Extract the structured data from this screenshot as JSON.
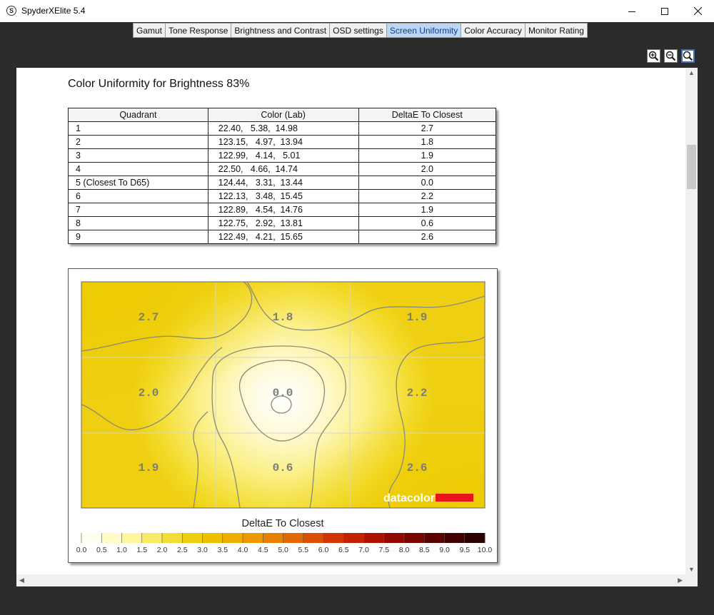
{
  "window": {
    "title": "SpyderXElite 5.4",
    "icon_letter": "S"
  },
  "tabs": [
    {
      "label": "Gamut",
      "active": false
    },
    {
      "label": "Tone Response",
      "active": false
    },
    {
      "label": "Brightness and Contrast",
      "active": false
    },
    {
      "label": "OSD settings",
      "active": false
    },
    {
      "label": "Screen Uniformity",
      "active": true
    },
    {
      "label": "Color Accuracy",
      "active": false
    },
    {
      "label": "Monitor Rating",
      "active": false
    }
  ],
  "report": {
    "heading": "Color Uniformity for Brightness 83%",
    "table": {
      "headers": [
        "Quadrant",
        "Color (Lab)",
        "DeltaE To Closest"
      ],
      "rows": [
        [
          "1",
          "22.40,   5.38,  14.98",
          "2.7"
        ],
        [
          "2",
          "123.15,   4.97,  13.94",
          "1.8"
        ],
        [
          "3",
          "122.99,   4.14,   5.01",
          "1.9"
        ],
        [
          "4",
          "22.50,   4.66,  14.74",
          "2.0"
        ],
        [
          "5 (Closest To D65)",
          "124.44,   3.31,  13.44",
          "0.0"
        ],
        [
          "6",
          "122.13,   3.48,  15.45",
          "2.2"
        ],
        [
          "7",
          "122.89,   4.54,  14.76",
          "1.9"
        ],
        [
          "8",
          "122.75,   2.92,  13.81",
          "0.6"
        ],
        [
          "9",
          "122.49,   4.21,  15.65",
          "2.6"
        ]
      ]
    },
    "uniformity_map": {
      "cells": [
        "2.7",
        "1.8",
        "1.9",
        "2.0",
        "0.0",
        "2.2",
        "1.9",
        "0.6",
        "2.6"
      ],
      "brand": "datacolor",
      "brand_color": "#e8141c"
    },
    "legend": {
      "title": "DeltaE To Closest",
      "labels": [
        "0.0",
        "0.5",
        "1.0",
        "1.5",
        "2.0",
        "2.5",
        "3.0",
        "3.5",
        "4.0",
        "4.5",
        "5.0",
        "5.5",
        "6.0",
        "6.5",
        "7.0",
        "7.5",
        "8.0",
        "8.5",
        "9.0",
        "9.5",
        "10.0"
      ],
      "colors": [
        "#fffff0",
        "#fffcc8",
        "#fff59a",
        "#f8ea66",
        "#f1dd33",
        "#eecf10",
        "#edc000",
        "#eeae00",
        "#ec9800",
        "#e88100",
        "#e36800",
        "#dc4f00",
        "#d23600",
        "#c32200",
        "#ae1300",
        "#950a00",
        "#7a0500",
        "#5d0200",
        "#420000",
        "#2a0000"
      ]
    }
  },
  "toolbar": {
    "zoom_in_icon": "zoom-in-icon",
    "zoom_out_icon": "zoom-out-icon",
    "zoom_fit_icon": "zoom-fit-icon"
  }
}
